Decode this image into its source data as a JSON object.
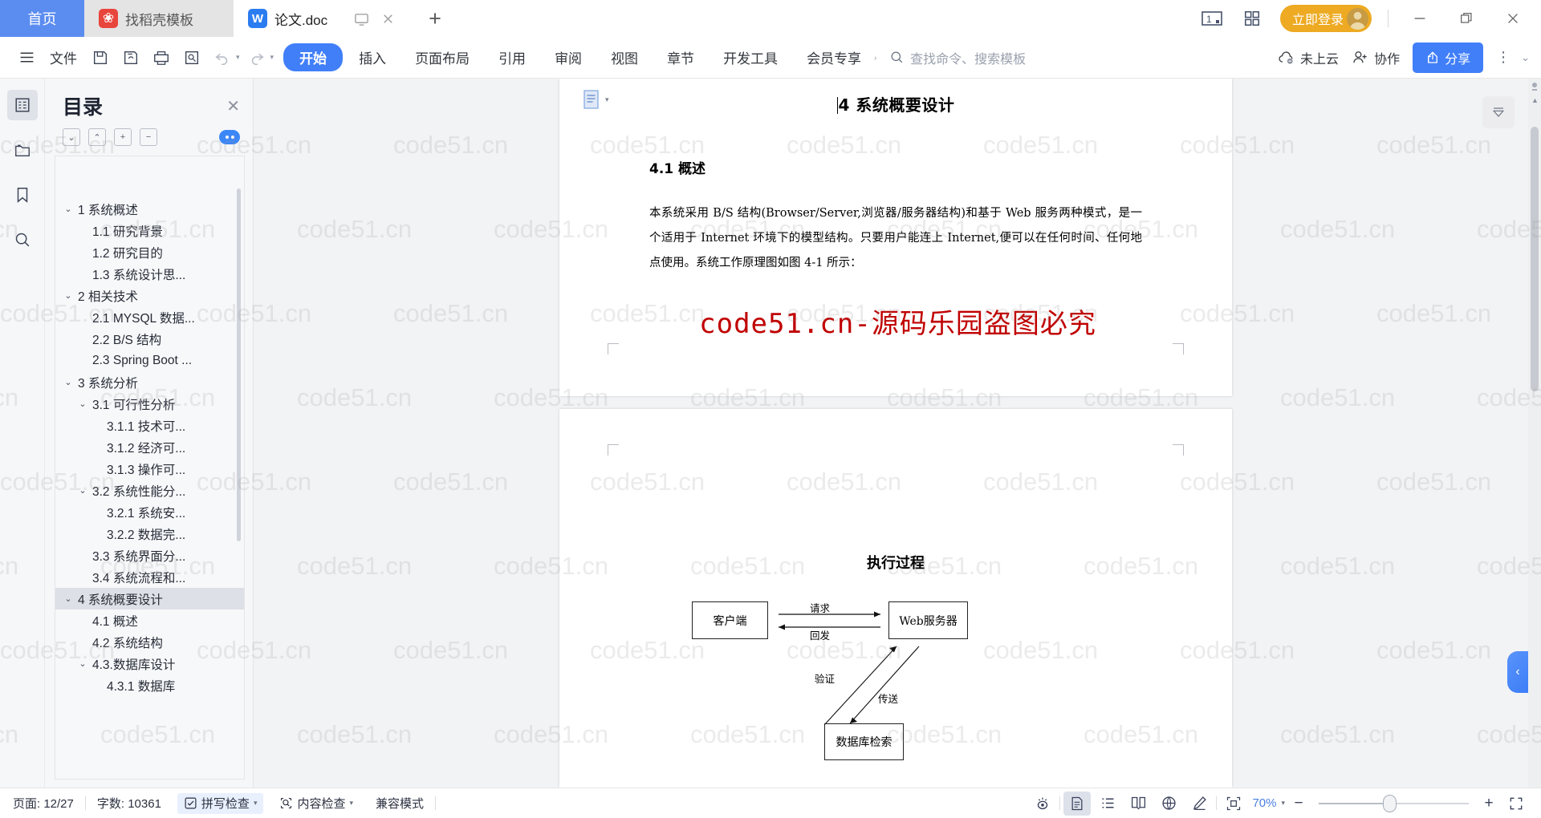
{
  "titlebar": {
    "tabs": [
      {
        "label": "首页",
        "type": "home"
      },
      {
        "label": "找稻壳模板",
        "type": "inactive",
        "icon": "daoke-icon"
      },
      {
        "label": "论文.doc",
        "type": "active",
        "icon": "wps-writer-icon"
      }
    ],
    "new_tab_label": "+",
    "login_label": "立即登录",
    "icons": [
      "page-count-icon",
      "grid-apps-icon",
      "minimize-icon",
      "restore-icon",
      "close-icon"
    ]
  },
  "ribbon": {
    "file_label": "文件",
    "quick_icons": [
      "save-icon",
      "save-as-icon",
      "print-icon",
      "print-preview-icon",
      "undo-icon",
      "redo-icon"
    ],
    "tabs": [
      {
        "label": "开始",
        "active": true
      },
      {
        "label": "插入",
        "active": false
      },
      {
        "label": "页面布局",
        "active": false
      },
      {
        "label": "引用",
        "active": false
      },
      {
        "label": "审阅",
        "active": false
      },
      {
        "label": "视图",
        "active": false
      },
      {
        "label": "章节",
        "active": false
      },
      {
        "label": "开发工具",
        "active": false
      },
      {
        "label": "会员专享",
        "active": false
      }
    ],
    "search_placeholder": "查找命令、搜索模板",
    "cloud_label": "未上云",
    "collab_label": "协作",
    "share_label": "分享"
  },
  "leftrail": {
    "items": [
      "outline-icon",
      "folder-nav-icon",
      "bookmark-icon",
      "search-icon"
    ]
  },
  "toc": {
    "title": "目录",
    "tools": [
      "expand-down-icon",
      "collapse-up-icon",
      "plus-icon",
      "minus-icon"
    ],
    "items": [
      {
        "label": "1 系统概述",
        "level": 1,
        "chevron": true,
        "selected": false
      },
      {
        "label": "1.1  研究背景",
        "level": 2,
        "chevron": false,
        "selected": false
      },
      {
        "label": "1.2 研究目的",
        "level": 2,
        "chevron": false,
        "selected": false
      },
      {
        "label": "1.3 系统设计思...",
        "level": 2,
        "chevron": false,
        "selected": false
      },
      {
        "label": "2 相关技术",
        "level": 1,
        "chevron": true,
        "selected": false
      },
      {
        "label": "2.1 MYSQL 数据...",
        "level": 2,
        "chevron": false,
        "selected": false
      },
      {
        "label": "2.2 B/S 结构",
        "level": 2,
        "chevron": false,
        "selected": false
      },
      {
        "label": "2.3 Spring Boot ...",
        "level": 2,
        "chevron": false,
        "selected": false
      },
      {
        "label": "3 系统分析",
        "level": 1,
        "chevron": true,
        "selected": false
      },
      {
        "label": "3.1 可行性分析",
        "level": 2,
        "chevron": true,
        "selected": false
      },
      {
        "label": "3.1.1 技术可...",
        "level": 3,
        "chevron": false,
        "selected": false
      },
      {
        "label": "3.1.2 经济可...",
        "level": 3,
        "chevron": false,
        "selected": false
      },
      {
        "label": "3.1.3 操作可...",
        "level": 3,
        "chevron": false,
        "selected": false
      },
      {
        "label": "3.2 系统性能分...",
        "level": 2,
        "chevron": true,
        "selected": false
      },
      {
        "label": "3.2.1  系统安...",
        "level": 3,
        "chevron": false,
        "selected": false
      },
      {
        "label": "3.2.2  数据完...",
        "level": 3,
        "chevron": false,
        "selected": false
      },
      {
        "label": "3.3 系统界面分...",
        "level": 2,
        "chevron": false,
        "selected": false
      },
      {
        "label": "3.4 系统流程和...",
        "level": 2,
        "chevron": false,
        "selected": false
      },
      {
        "label": "4 系统概要设计",
        "level": 1,
        "chevron": true,
        "selected": true
      },
      {
        "label": "4.1 概述",
        "level": 2,
        "chevron": false,
        "selected": false
      },
      {
        "label": "4.2 系统结构",
        "level": 2,
        "chevron": false,
        "selected": false
      },
      {
        "label": "4.3.数据库设计",
        "level": 2,
        "chevron": true,
        "selected": false
      },
      {
        "label": "4.3.1 数据库",
        "level": 3,
        "chevron": false,
        "selected": false
      }
    ]
  },
  "document": {
    "heading1": "4 系统概要设计",
    "heading2": "4.1 概述",
    "paragraph": "本系统采用 B/S 结构(Browser/Server,浏览器/服务器结构)和基于 Web 服务两种模式，是一个适用于 Internet 环境下的模型结构。只要用户能连上 Internet,便可以在任何时间、任何地点使用。系统工作原理图如图 4-1 所示：",
    "red_watermark": "code51.cn-源码乐园盗图必究",
    "figure": {
      "title": "执行过程",
      "nodes": [
        {
          "id": "client",
          "label": "客户端"
        },
        {
          "id": "webserver",
          "label": "Web服务器"
        },
        {
          "id": "database",
          "label": "数据库检索"
        }
      ],
      "edges": [
        {
          "label": "请求",
          "from": "client",
          "to": "webserver"
        },
        {
          "label": "回发",
          "from": "webserver",
          "to": "client"
        },
        {
          "label": "验证",
          "from": "database",
          "to": "webserver"
        },
        {
          "label": "传送",
          "from": "webserver",
          "to": "database"
        }
      ]
    },
    "watermark_tile": "code51.cn"
  },
  "statusbar": {
    "page_label": "页面: 12/27",
    "words_label": "字数: 10361",
    "spellcheck_label": "拼写检查",
    "contentcheck_label": "内容检查",
    "compat_label": "兼容模式",
    "zoom_label": "70%",
    "view_icons": [
      "eye-protect-icon",
      "print-layout-icon",
      "outline-view-icon",
      "reading-view-icon",
      "web-layout-icon",
      "pen-edit-icon",
      "fit-page-icon"
    ],
    "zoom_out_label": "−",
    "zoom_in_label": "+",
    "fullscreen_icon": "fullscreen-icon"
  },
  "colors": {
    "accent_blue": "#417ff9",
    "home_tab_blue": "#5b8cf0",
    "login_orange": "#edaa22",
    "watermark_red": "#c00000",
    "zoom_text_blue": "#4b7fe0"
  }
}
